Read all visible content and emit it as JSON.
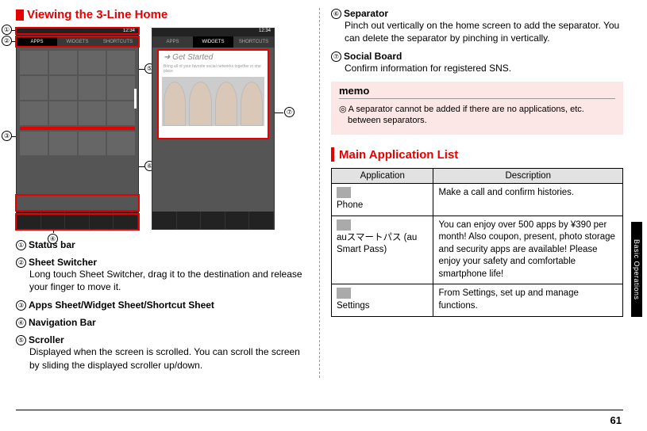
{
  "left_heading": "Viewing the 3-Line Home",
  "right_heading": "Main Application List",
  "callouts": {
    "c1": "①",
    "c2": "②",
    "c3": "③",
    "c4": "④",
    "c5": "⑤",
    "c6": "⑥",
    "c7": "⑦"
  },
  "phone": {
    "time": "12:34",
    "tabs": {
      "apps": "APPS",
      "widgets": "WIDGETS",
      "shortcuts": "SHORTCUTS"
    },
    "get_started": "Get Started",
    "get_started_desc": "Bring all of your favorite social networks together in one place"
  },
  "items_left": [
    {
      "num": "①",
      "title": "Status bar",
      "desc": ""
    },
    {
      "num": "②",
      "title": "Sheet Switcher",
      "desc": "Long touch Sheet Switcher, drag it to the destination and release your finger to move it."
    },
    {
      "num": "③",
      "title": "Apps Sheet/Widget Sheet/Shortcut Sheet",
      "desc": ""
    },
    {
      "num": "④",
      "title": "Navigation Bar",
      "desc": ""
    },
    {
      "num": "⑤",
      "title": "Scroller",
      "desc": "Displayed when the screen is scrolled. You can scroll the screen by sliding the displayed scroller up/down."
    }
  ],
  "items_right": [
    {
      "num": "⑥",
      "title": "Separator",
      "desc": "Pinch out vertically on the home screen to add the separator. You can delete the separator by pinching in vertically."
    },
    {
      "num": "⑦",
      "title": "Social Board",
      "desc": "Confirm information for registered SNS."
    }
  ],
  "memo": {
    "title": "memo",
    "bullet": "◎",
    "text": "A separator cannot be added if there are no applications, etc. between separators."
  },
  "table": {
    "headers": {
      "app": "Application",
      "desc": "Description"
    },
    "rows": [
      {
        "name": "Phone",
        "desc": "Make a call and confirm histories."
      },
      {
        "name": "auスマートパス (au Smart Pass)",
        "desc": "You can enjoy over 500 apps by ¥390 per month! Also coupon, present, photo storage and security apps are available! Please enjoy your safety and comfortable smartphone life!"
      },
      {
        "name": "Settings",
        "desc": "From Settings, set up and manage functions."
      }
    ]
  },
  "side_tab": "Basic Operations",
  "page_number": "61"
}
